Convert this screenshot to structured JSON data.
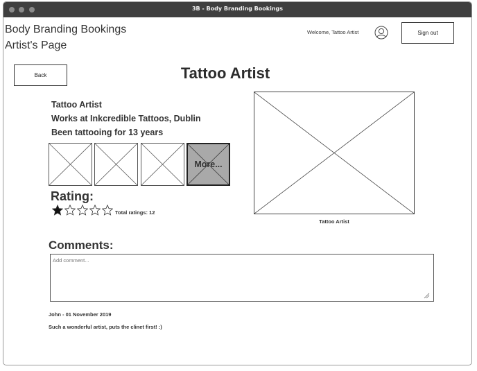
{
  "window": {
    "title": "3B - Body Branding Bookings"
  },
  "header": {
    "brand_line1": "Body Branding Bookings",
    "brand_line2": "Artist's Page",
    "welcome": "Welcome, Tattoo Artist",
    "signout_label": "Sign out"
  },
  "nav": {
    "back_label": "Back"
  },
  "page": {
    "title": "Tattoo Artist"
  },
  "artist": {
    "name": "Tattoo Artist",
    "workplace": "Works at Inkcredible Tattoos, Dublin",
    "experience": "Been tattooing for 13 years"
  },
  "gallery": {
    "more_label": "More..."
  },
  "rating": {
    "title": "Rating:",
    "value": 1,
    "max": 5,
    "total_label": "Total ratings: 12"
  },
  "main_image": {
    "caption": "Tattoo Artist"
  },
  "comments": {
    "title": "Comments:",
    "placeholder": "Add comment...",
    "items": [
      {
        "meta": "John - 01 November 2019",
        "text": "Such a wonderful artist, puts the clinet first! :)"
      }
    ]
  }
}
